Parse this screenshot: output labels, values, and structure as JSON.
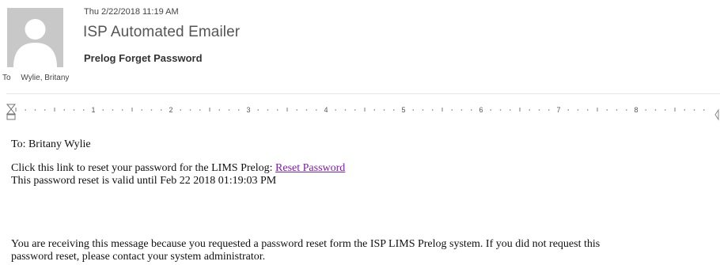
{
  "header": {
    "date": "Thu 2/22/2018 11:19 AM",
    "sender": "ISP Automated Emailer",
    "subject": "Prelog Forget Password",
    "to_label": "To",
    "to_name": "Wylie, Britany"
  },
  "ruler": {
    "numbers": [
      "1",
      "2",
      "3",
      "4",
      "5",
      "6",
      "7",
      "8"
    ]
  },
  "body": {
    "greeting": "To: Britany Wylie",
    "line1_prefix": "Click this link to reset your password for the LIMS Prelog:",
    "reset_link": "Reset Password",
    "line2": "This password reset is valid until Feb 22 2018 01:19:03 PM",
    "footer_line1": "You are receiving this message because you requested a password reset form the ISP LIMS Prelog system. If you did not request this",
    "footer_line2": "password reset, please contact your system administrator."
  },
  "colors": {
    "link": "#7b1fa2",
    "avatar_bg": "#c8c8c8"
  }
}
